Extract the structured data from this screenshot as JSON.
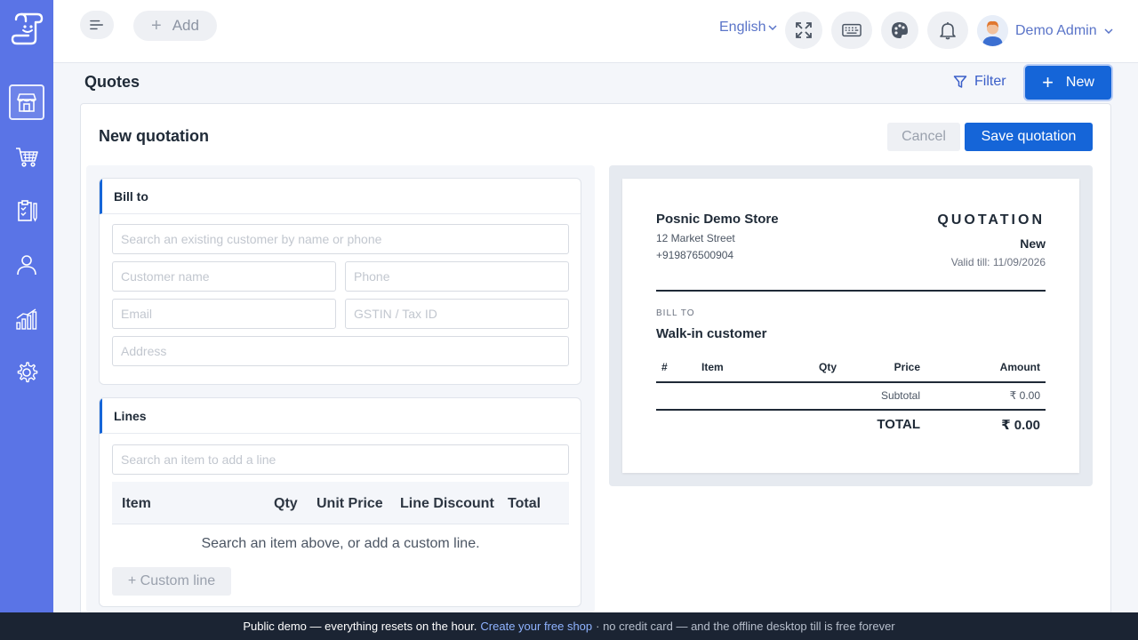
{
  "topbar": {
    "add_label": "Add",
    "language": "English",
    "user_name": "Demo Admin"
  },
  "page": {
    "title": "Quotes",
    "filter_label": "Filter",
    "new_label": "New"
  },
  "form": {
    "title": "New quotation",
    "cancel_label": "Cancel",
    "save_label": "Save quotation",
    "bill_to": {
      "heading": "Bill to",
      "search_placeholder": "Search an existing customer by name or phone",
      "name_placeholder": "Customer name",
      "phone_placeholder": "Phone",
      "email_placeholder": "Email",
      "gstin_placeholder": "GSTIN / Tax ID",
      "address_placeholder": "Address"
    },
    "lines": {
      "heading": "Lines",
      "search_placeholder": "Search an item to add a line",
      "columns": [
        "Item",
        "Qty",
        "Unit Price",
        "Line Discount",
        "Total"
      ],
      "empty_message": "Search an item above, or add a custom line.",
      "custom_line_label": "+ Custom line"
    }
  },
  "preview": {
    "store_name": "Posnic Demo Store",
    "address": "12 Market Street",
    "phone": "+919876500904",
    "doc_title": "QUOTATION",
    "status": "New",
    "valid_till": "Valid till: 11/09/2026",
    "bill_to_label": "BILL TO",
    "customer": "Walk-in customer",
    "columns": [
      "#",
      "Item",
      "Qty",
      "Price",
      "Amount"
    ],
    "subtotal_label": "Subtotal",
    "subtotal_value": "₹ 0.00",
    "total_label": "TOTAL",
    "total_value": "₹ 0.00"
  },
  "footer": {
    "lead": "Public demo — everything resets on the hour.",
    "link": "Create your free shop",
    "tail": "· no credit card — and the offline desktop till is free forever"
  },
  "colors": {
    "sidebar": "#5a74e6",
    "primary": "#1565d8",
    "footer": "#1b2433"
  }
}
